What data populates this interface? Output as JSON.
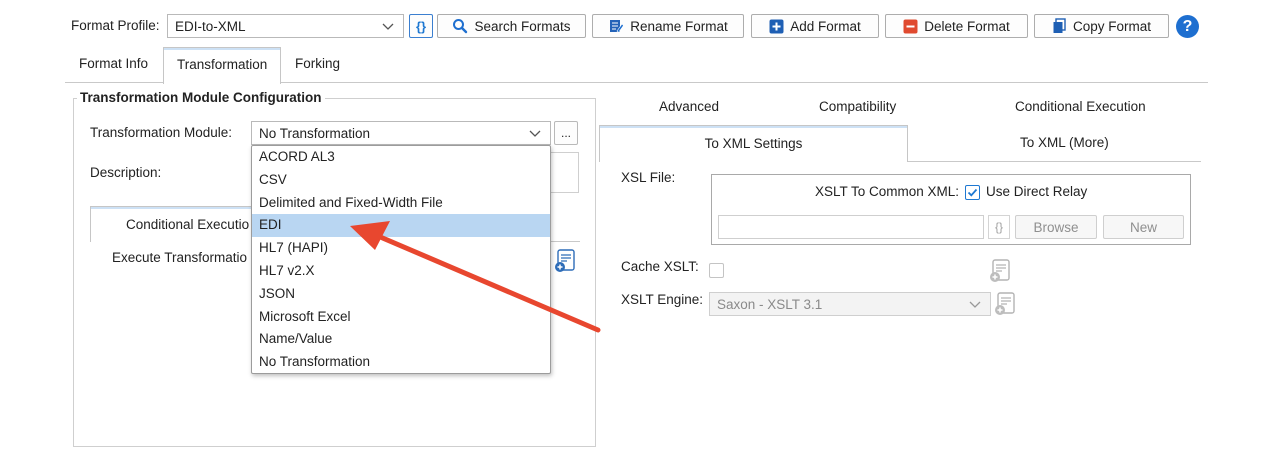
{
  "toolbar": {
    "format_profile_label": "Format Profile:",
    "format_profile_value": "EDI-to-XML",
    "search_label": "Search Formats",
    "rename_label": "Rename Format",
    "add_label": "Add Format",
    "delete_label": "Delete Format",
    "copy_label": "Copy Format",
    "help_glyph": "?"
  },
  "main_tabs": [
    {
      "label": "Format Info",
      "active": false
    },
    {
      "label": "Transformation",
      "active": true
    },
    {
      "label": "Forking",
      "active": false
    }
  ],
  "left_panel": {
    "group_title": "Transformation Module Configuration",
    "module_label": "Transformation Module:",
    "module_value": "No Transformation",
    "more_button": "...",
    "description_label": "Description:",
    "sub_tab_label": "Conditional Executio",
    "execute_label": "Execute Transformatio"
  },
  "dropdown": {
    "items": [
      "ACORD AL3",
      "CSV",
      "Delimited and Fixed-Width File",
      "EDI",
      "HL7 (HAPI)",
      "HL7 v2.X",
      "JSON",
      "Microsoft Excel",
      "Name/Value",
      "No Transformation"
    ],
    "selected": "EDI"
  },
  "right_panel": {
    "tabs_row1": [
      "Advanced",
      "Compatibility",
      "Conditional Execution"
    ],
    "tabs_row2": [
      {
        "label": "To XML Settings",
        "active": true
      },
      {
        "label": "To XML (More)",
        "active": false
      }
    ],
    "xsl_file_label": "XSL File:",
    "xslt_common_label": "XSLT To Common XML:",
    "use_direct_relay_label": "Use Direct Relay",
    "use_direct_relay_checked": true,
    "browse_label": "Browse",
    "new_label": "New",
    "cache_xslt_label": "Cache XSLT:",
    "xslt_engine_label": "XSLT Engine:",
    "xslt_engine_value": "Saxon - XSLT 3.1"
  },
  "colors": {
    "accent": "#1e78d2",
    "selection": "#b9d6f2",
    "arrow": "#e8472f",
    "delete_red": "#e04a2f",
    "help_blue": "#1e6fd0"
  }
}
